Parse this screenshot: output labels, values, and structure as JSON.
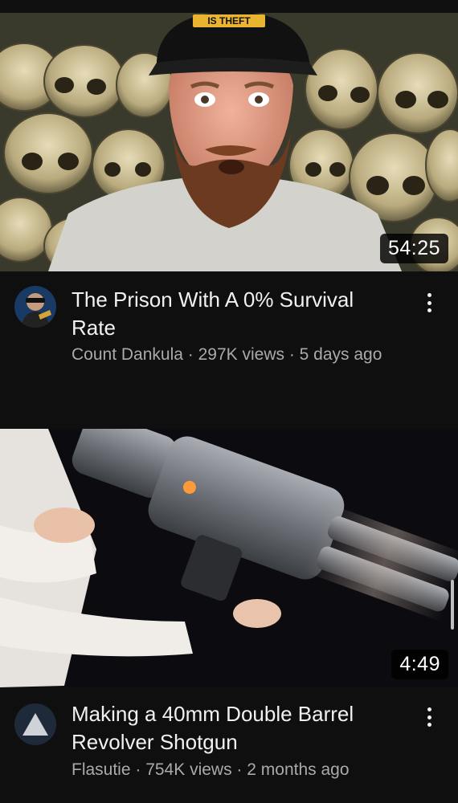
{
  "feed": {
    "videos": [
      {
        "duration": "54:25",
        "title": "The Prison With A 0% Survival Rate",
        "channel": "Count Dankula",
        "views": "297K views",
        "age": "5 days ago",
        "thumbnail_text": "IS THEFT"
      },
      {
        "duration": "4:49",
        "title": "Making a 40mm Double Barrel Revolver Shotgun",
        "channel": "Flasutie",
        "views": "754K views",
        "age": "2 months ago"
      }
    ],
    "separator": " · "
  },
  "icons": {
    "menu": "more-vert-icon",
    "avatar2": "triangle-logo-icon"
  },
  "colors": {
    "background": "#0f0f0f",
    "title": "#f1f1f1",
    "subtitle": "#aaaaaa",
    "duration_bg": "#000000"
  }
}
